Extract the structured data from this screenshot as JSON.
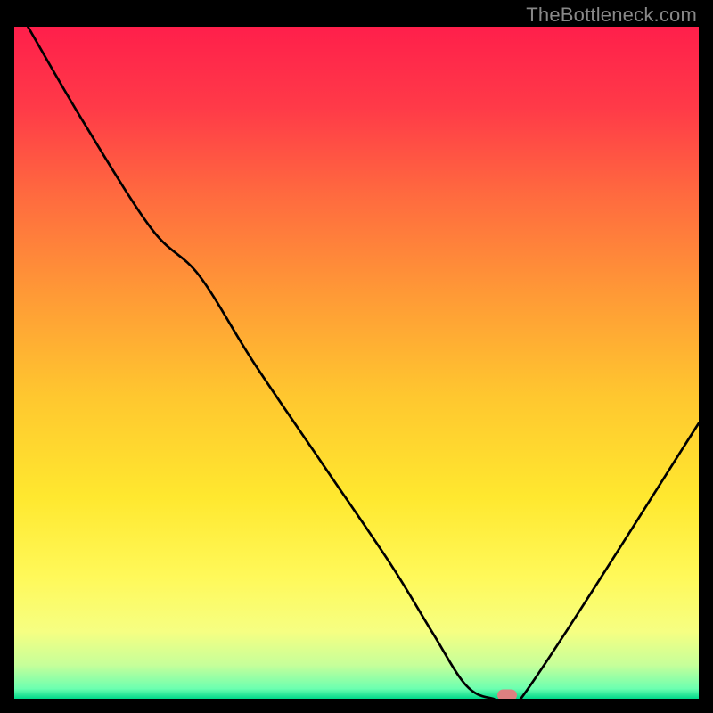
{
  "watermark": "TheBottleneck.com",
  "chart_data": {
    "type": "line",
    "title": "",
    "xlabel": "",
    "ylabel": "",
    "x_range": [
      0,
      100
    ],
    "y_range": [
      0,
      100
    ],
    "series": [
      {
        "name": "curve",
        "x": [
          2,
          10,
          20,
          27,
          35,
          45,
          55,
          61,
          66,
          70,
          74,
          100
        ],
        "y": [
          100,
          86,
          70,
          63,
          50,
          35,
          20,
          10,
          2,
          0,
          0,
          41
        ]
      }
    ],
    "marker": {
      "x": 72,
      "y": 0
    },
    "gradient_stops": [
      {
        "pos": 0.0,
        "color": "#ff1f4b"
      },
      {
        "pos": 0.12,
        "color": "#ff3a48"
      },
      {
        "pos": 0.25,
        "color": "#ff6a3f"
      },
      {
        "pos": 0.4,
        "color": "#ff9a36"
      },
      {
        "pos": 0.55,
        "color": "#ffc72f"
      },
      {
        "pos": 0.7,
        "color": "#ffe82f"
      },
      {
        "pos": 0.82,
        "color": "#fff95a"
      },
      {
        "pos": 0.9,
        "color": "#f6ff82"
      },
      {
        "pos": 0.95,
        "color": "#c6ff9a"
      },
      {
        "pos": 0.985,
        "color": "#6cffb0"
      },
      {
        "pos": 1.0,
        "color": "#00d88a"
      }
    ]
  }
}
